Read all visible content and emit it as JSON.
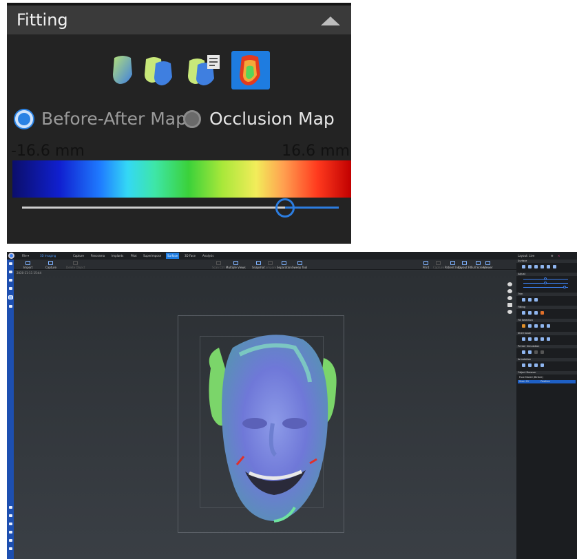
{
  "zoom_panel": {
    "title": "Fitting",
    "buttons": [
      {
        "icon": "face-scan-icon"
      },
      {
        "icon": "face-overlay-icon"
      },
      {
        "icon": "face-report-icon"
      },
      {
        "icon": "face-colormap-icon",
        "selected": true
      }
    ],
    "radio_options": [
      {
        "label": "Before-After Map",
        "selected": true
      },
      {
        "label": "Occlusion Map",
        "selected": false
      }
    ],
    "range_min": "-16.6 mm",
    "range_max": "16.6 mm",
    "slider_value_fraction": 0.83
  },
  "app": {
    "file_menu": "File ▾",
    "menu_tabs": [
      "3D Imaging",
      "Capture",
      "Panorama",
      "Implants",
      "Pilot",
      "Superimpose",
      "Surface",
      "3D Face",
      "Analysis"
    ],
    "active_tab": "Surface",
    "toolbar_left": [
      "Import",
      "Capture",
      "Delete Object"
    ],
    "toolbar_mid": [
      "Scan Ctrl",
      "Multiple Views"
    ],
    "toolbar_right_left": [
      "Snapshot",
      "Compare",
      "Separation",
      "Sweep Tool"
    ],
    "toolbar_right": [
      "Print",
      "Capture",
      "Patient Info",
      "Layout Fit",
      "Full Screen",
      "Viewer"
    ],
    "date_label": "2020-11-11 15:44",
    "user_label": "Layout: Live",
    "accent_color": "#1e7ce0",
    "right_panel": {
      "sections": [
        "Surface",
        "Adjust",
        "Trim",
        "Fitting",
        "Fill Selection",
        "Shell Scale",
        "Printer Simulation",
        "Annotation",
        "Object Browser"
      ],
      "objects": [
        {
          "name": "Face Model (Before)",
          "status": ""
        },
        {
          "name": "Scan 01",
          "status": "Position"
        }
      ]
    }
  }
}
